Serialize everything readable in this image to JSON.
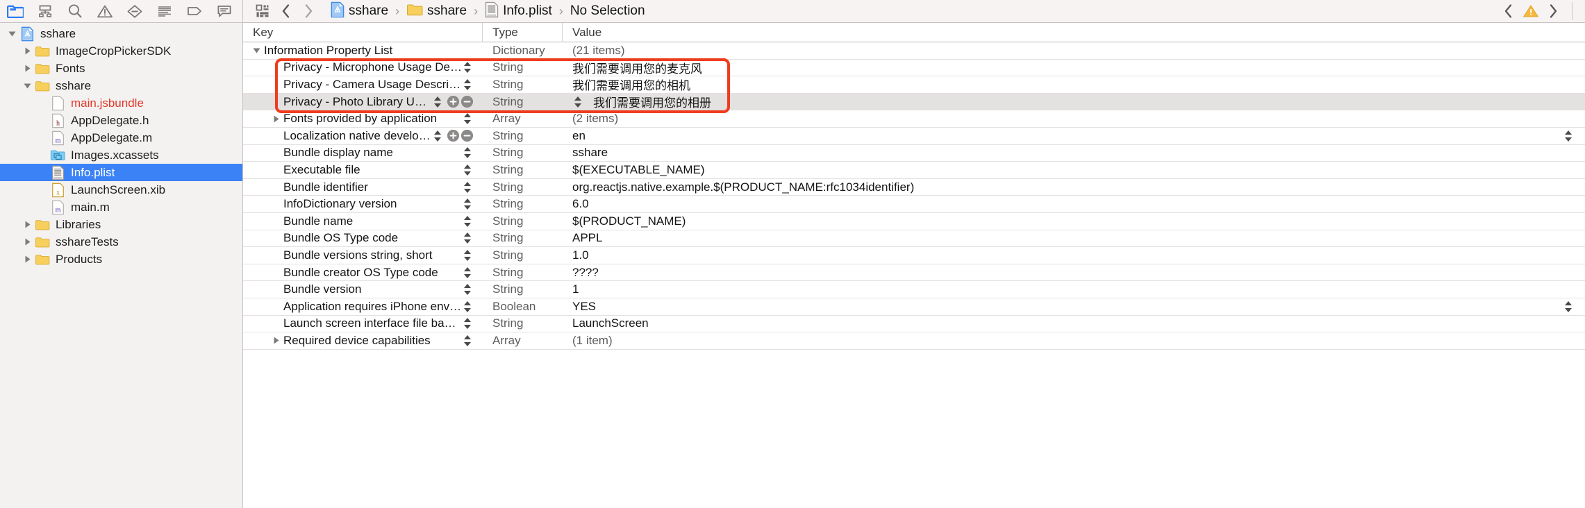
{
  "toolbar": {
    "nav_icons": [
      {
        "name": "folder-icon",
        "label": "Project navigator",
        "active": true
      },
      {
        "name": "hierarchy-icon",
        "label": "Symbol navigator",
        "active": false
      },
      {
        "name": "search-icon",
        "label": "Find navigator",
        "active": false
      },
      {
        "name": "warning-triangle-icon",
        "label": "Issue navigator",
        "active": false
      },
      {
        "name": "minus-diamond-icon",
        "label": "Test navigator",
        "active": false
      },
      {
        "name": "list-lines-icon",
        "label": "Debug navigator",
        "active": false
      },
      {
        "name": "tag-icon",
        "label": "Breakpoint navigator",
        "active": false
      },
      {
        "name": "comment-bubble-icon",
        "label": "Report navigator",
        "active": false
      }
    ],
    "editor_mode_icon": "grid-squares-icon",
    "back_icon": "chevron-left-icon",
    "forward_icon": "chevron-right-icon",
    "right_prev_icon": "chevron-left-icon",
    "right_warning_icon": "warning-triangle-yellow-icon",
    "right_next_icon": "chevron-right-icon"
  },
  "breadcrumb": {
    "separator": "›",
    "items": [
      {
        "label": "sshare",
        "icon": "xcode-project-icon"
      },
      {
        "label": "sshare",
        "icon": "folder-icon"
      },
      {
        "label": "Info.plist",
        "icon": "plist-file-icon"
      },
      {
        "label": "No Selection",
        "icon": ""
      }
    ]
  },
  "sidebar": {
    "items": [
      {
        "label": "sshare",
        "icon": "xcode-project-icon",
        "indent": 0,
        "disclosure": "open",
        "selected": false
      },
      {
        "label": "ImageCropPickerSDK",
        "icon": "folder-icon",
        "indent": 1,
        "disclosure": "closed",
        "selected": false
      },
      {
        "label": "Fonts",
        "icon": "folder-icon",
        "indent": 1,
        "disclosure": "closed",
        "selected": false
      },
      {
        "label": "sshare",
        "icon": "folder-icon",
        "indent": 1,
        "disclosure": "open",
        "selected": false
      },
      {
        "label": "main.jsbundle",
        "icon": "blank-file-icon",
        "indent": 2,
        "disclosure": "none",
        "selected": false,
        "red": true
      },
      {
        "label": "AppDelegate.h",
        "icon": "h-file-icon",
        "indent": 2,
        "disclosure": "none",
        "selected": false
      },
      {
        "label": "AppDelegate.m",
        "icon": "m-file-icon",
        "indent": 2,
        "disclosure": "none",
        "selected": false
      },
      {
        "label": "Images.xcassets",
        "icon": "xcassets-icon",
        "indent": 2,
        "disclosure": "none",
        "selected": false
      },
      {
        "label": "Info.plist",
        "icon": "plist-file-icon",
        "indent": 2,
        "disclosure": "none",
        "selected": true
      },
      {
        "label": "LaunchScreen.xib",
        "icon": "xib-file-icon",
        "indent": 2,
        "disclosure": "none",
        "selected": false
      },
      {
        "label": "main.m",
        "icon": "m-file-icon",
        "indent": 2,
        "disclosure": "none",
        "selected": false
      },
      {
        "label": "Libraries",
        "icon": "folder-icon",
        "indent": 1,
        "disclosure": "closed",
        "selected": false
      },
      {
        "label": "sshareTests",
        "icon": "folder-icon",
        "indent": 1,
        "disclosure": "closed",
        "selected": false
      },
      {
        "label": "Products",
        "icon": "folder-icon",
        "indent": 1,
        "disclosure": "closed",
        "selected": false
      }
    ]
  },
  "plist": {
    "columns": {
      "key": "Key",
      "type": "Type",
      "value": "Value"
    },
    "rows": [
      {
        "key": "Information Property List",
        "type": "Dictionary",
        "value": "(21 items)",
        "indent": 0,
        "disclosure": "open",
        "type_gray": true,
        "value_gray": true,
        "sortctl": false
      },
      {
        "key": "Privacy - Microphone Usage Desc…",
        "type": "String",
        "value": "我们需要调用您的麦克风",
        "indent": 1,
        "disclosure": "none",
        "type_gray": true,
        "value_gray": false,
        "sortctl": true,
        "highlighted": true
      },
      {
        "key": "Privacy - Camera Usage Description",
        "type": "String",
        "value": "我们需要调用您的相机",
        "indent": 1,
        "disclosure": "none",
        "type_gray": true,
        "value_gray": false,
        "sortctl": true,
        "highlighted": true
      },
      {
        "key": "Privacy - Photo Library Usag…",
        "type": "String",
        "value": "我们需要调用您的相册",
        "indent": 1,
        "disclosure": "none",
        "type_gray": false,
        "value_gray": false,
        "sortctl": true,
        "pm": true,
        "selectedRow": true,
        "valctl": true,
        "highlighted": true
      },
      {
        "key": "Fonts provided by application",
        "type": "Array",
        "value": "(2 items)",
        "indent": 1,
        "disclosure": "closed",
        "type_gray": true,
        "value_gray": true,
        "sortctl": true
      },
      {
        "key": "Localization native developm…",
        "type": "String",
        "value": "en",
        "indent": 1,
        "disclosure": "none",
        "type_gray": true,
        "value_gray": false,
        "sortctl": true,
        "pm": true,
        "valright": true
      },
      {
        "key": "Bundle display name",
        "type": "String",
        "value": "sshare",
        "indent": 1,
        "disclosure": "none",
        "type_gray": true,
        "value_gray": false,
        "sortctl": true
      },
      {
        "key": "Executable file",
        "type": "String",
        "value": "$(EXECUTABLE_NAME)",
        "indent": 1,
        "disclosure": "none",
        "type_gray": true,
        "value_gray": false,
        "sortctl": true
      },
      {
        "key": "Bundle identifier",
        "type": "String",
        "value": "org.reactjs.native.example.$(PRODUCT_NAME:rfc1034identifier)",
        "indent": 1,
        "disclosure": "none",
        "type_gray": true,
        "value_gray": false,
        "sortctl": true
      },
      {
        "key": "InfoDictionary version",
        "type": "String",
        "value": "6.0",
        "indent": 1,
        "disclosure": "none",
        "type_gray": true,
        "value_gray": false,
        "sortctl": true
      },
      {
        "key": "Bundle name",
        "type": "String",
        "value": "$(PRODUCT_NAME)",
        "indent": 1,
        "disclosure": "none",
        "type_gray": true,
        "value_gray": false,
        "sortctl": true
      },
      {
        "key": "Bundle OS Type code",
        "type": "String",
        "value": "APPL",
        "indent": 1,
        "disclosure": "none",
        "type_gray": true,
        "value_gray": false,
        "sortctl": true
      },
      {
        "key": "Bundle versions string, short",
        "type": "String",
        "value": "1.0",
        "indent": 1,
        "disclosure": "none",
        "type_gray": true,
        "value_gray": false,
        "sortctl": true
      },
      {
        "key": "Bundle creator OS Type code",
        "type": "String",
        "value": "????",
        "indent": 1,
        "disclosure": "none",
        "type_gray": true,
        "value_gray": false,
        "sortctl": true
      },
      {
        "key": "Bundle version",
        "type": "String",
        "value": "1",
        "indent": 1,
        "disclosure": "none",
        "type_gray": true,
        "value_gray": false,
        "sortctl": true
      },
      {
        "key": "Application requires iPhone enviro…",
        "type": "Boolean",
        "value": "YES",
        "indent": 1,
        "disclosure": "none",
        "type_gray": true,
        "value_gray": false,
        "sortctl": true,
        "valright": true
      },
      {
        "key": "Launch screen interface file base…",
        "type": "String",
        "value": "LaunchScreen",
        "indent": 1,
        "disclosure": "none",
        "type_gray": true,
        "value_gray": false,
        "sortctl": true
      },
      {
        "key": "Required device capabilities",
        "type": "Array",
        "value": "(1 item)",
        "indent": 1,
        "disclosure": "closed",
        "type_gray": true,
        "value_gray": true,
        "sortctl": true
      }
    ]
  },
  "colors": {
    "accent_blue": "#3b82f6",
    "highlight_red": "#f03c1e",
    "folder_yellow": "#f5ca4a",
    "warning_yellow": "#f6b83c",
    "red_text": "#e2382b",
    "toolbar_bg": "#f6f3f2",
    "sidebar_bg": "#f4f2f0"
  }
}
